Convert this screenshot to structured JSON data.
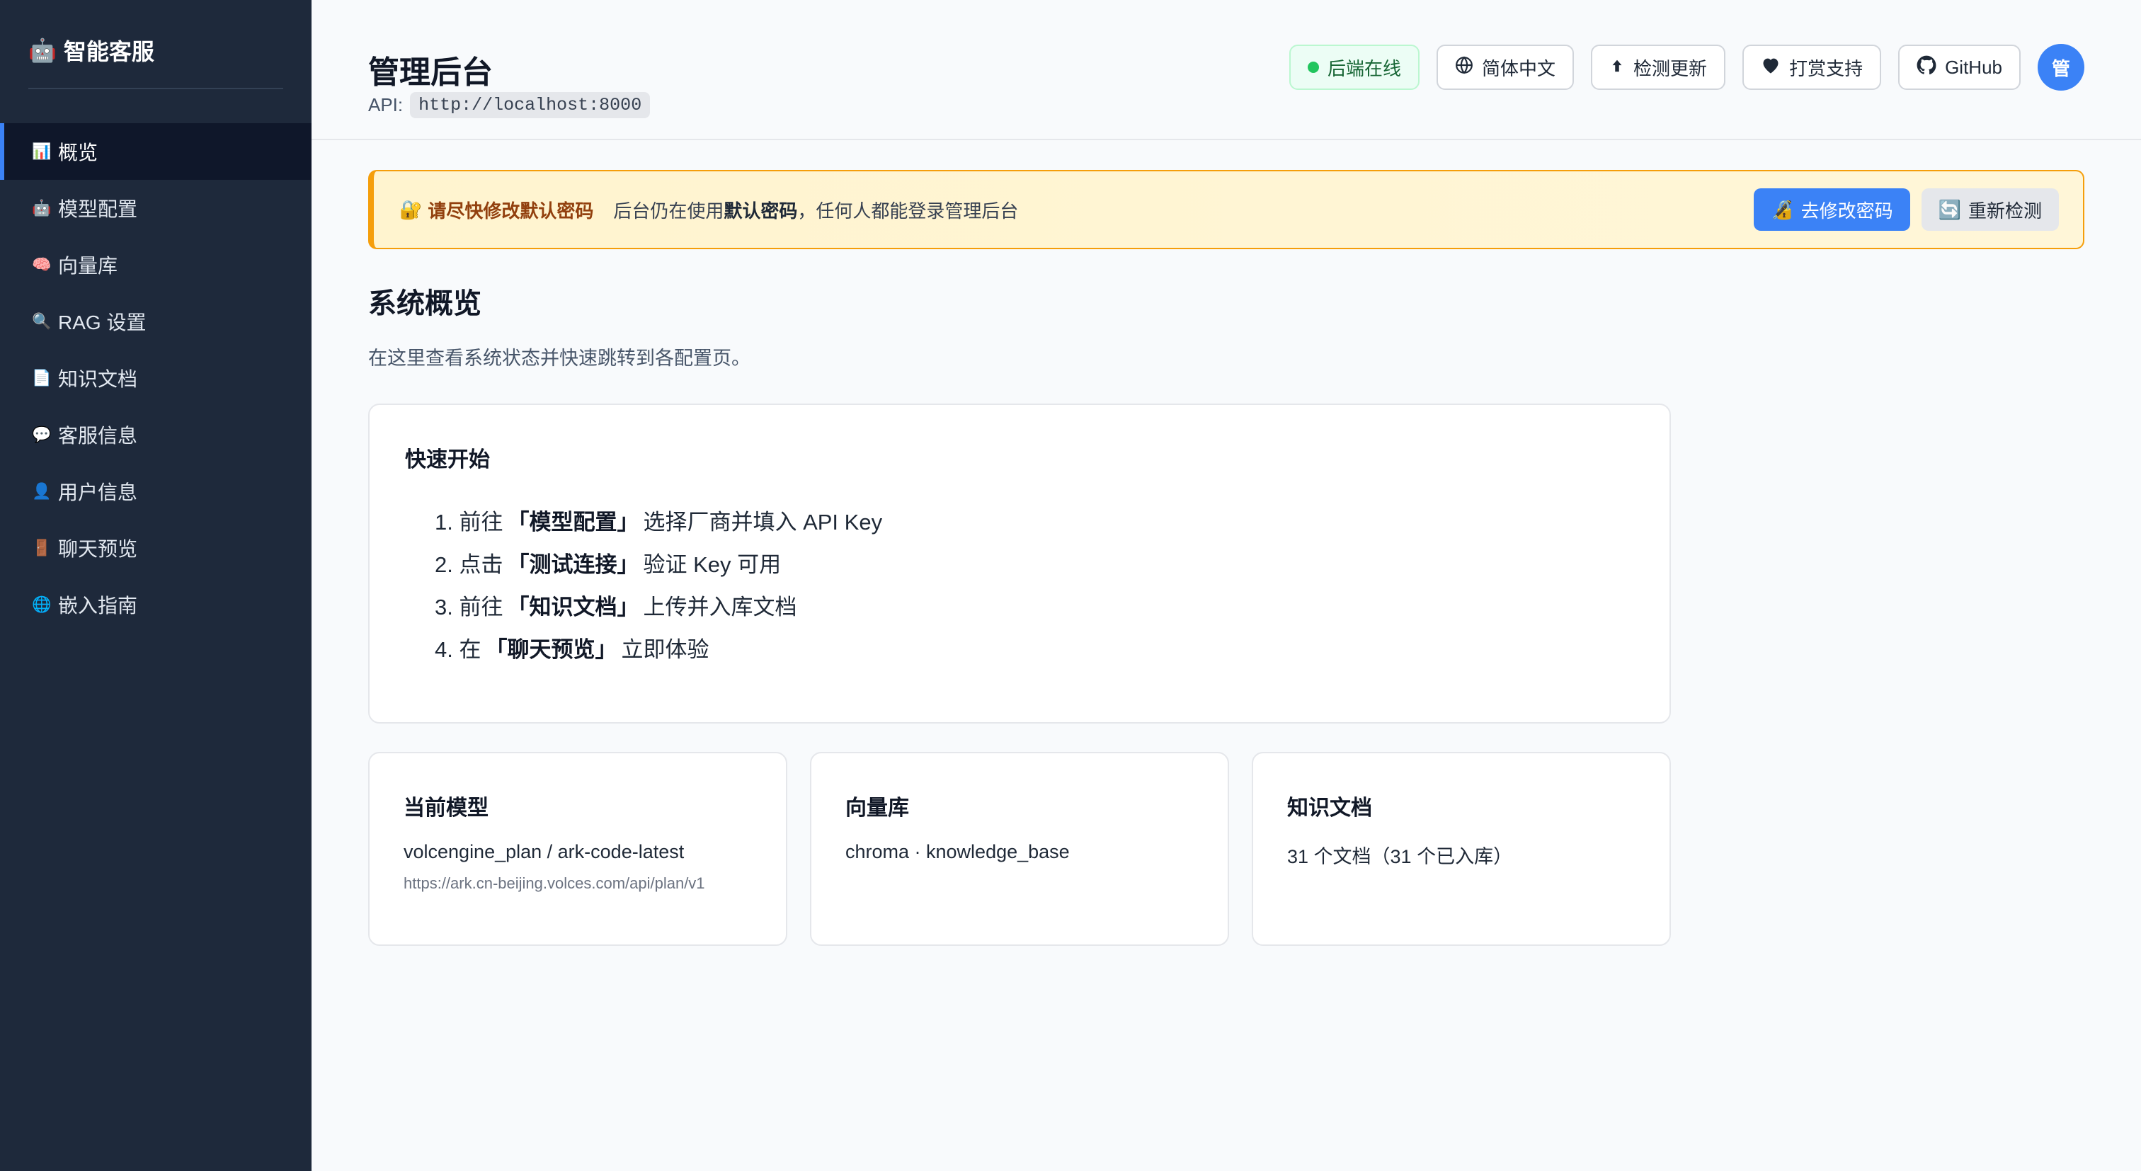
{
  "sidebar": {
    "brand": "智能客服",
    "brand_icon": "robot-icon",
    "items": [
      {
        "icon": "📊",
        "label": "概览",
        "active": true
      },
      {
        "icon": "🤖",
        "label": "模型配置"
      },
      {
        "icon": "🧠",
        "label": "向量库"
      },
      {
        "icon": "🔍",
        "label": "RAG 设置"
      },
      {
        "icon": "📄",
        "label": "知识文档"
      },
      {
        "icon": "💬",
        "label": "客服信息"
      },
      {
        "icon": "👤",
        "label": "用户信息"
      },
      {
        "icon": "🚪",
        "label": "聊天预览"
      },
      {
        "icon": "🌐",
        "label": "嵌入指南"
      }
    ]
  },
  "header": {
    "title": "管理后台",
    "api_label": "API:",
    "api_url": "http://localhost:8000",
    "status": "后端在线",
    "language": "简体中文",
    "check_update": "检测更新",
    "donate": "打赏支持",
    "github": "GitHub",
    "avatar": "管"
  },
  "banner": {
    "title": "请尽快修改默认密码",
    "msg_prefix": "后台仍在使用",
    "msg_bold": "默认密码",
    "msg_suffix": "，任何人都能登录管理后台",
    "primary_btn": "去修改密码",
    "secondary_btn": "重新检测"
  },
  "overview": {
    "title": "系统概览",
    "description": "在这里查看系统状态并快速跳转到各配置页。"
  },
  "quick_start": {
    "title": "快速开始",
    "steps": [
      {
        "prefix": "1. 前往",
        "bold": "「模型配置」",
        "suffix": "选择厂商并填入 API Key"
      },
      {
        "prefix": "2. 点击",
        "bold": "「测试连接」",
        "suffix": "验证 Key 可用"
      },
      {
        "prefix": "3. 前往",
        "bold": "「知识文档」",
        "suffix": "上传并入库文档"
      },
      {
        "prefix": "4. 在",
        "bold": "「聊天预览」",
        "suffix": "立即体验"
      }
    ]
  },
  "cards": {
    "model": {
      "title": "当前模型",
      "value": "volcengine_plan / ark-code-latest",
      "url": "https://ark.cn-beijing.volces.com/api/plan/v1"
    },
    "vector": {
      "title": "向量库",
      "value": "chroma · knowledge_base"
    },
    "docs": {
      "title": "知识文档",
      "value": "31 个文档（31 个已入库）"
    }
  },
  "colors": {
    "sidebar_bg": "#1e293b",
    "accent": "#3b82f6",
    "status_green": "#22c55e",
    "warning": "#f59e0b"
  }
}
